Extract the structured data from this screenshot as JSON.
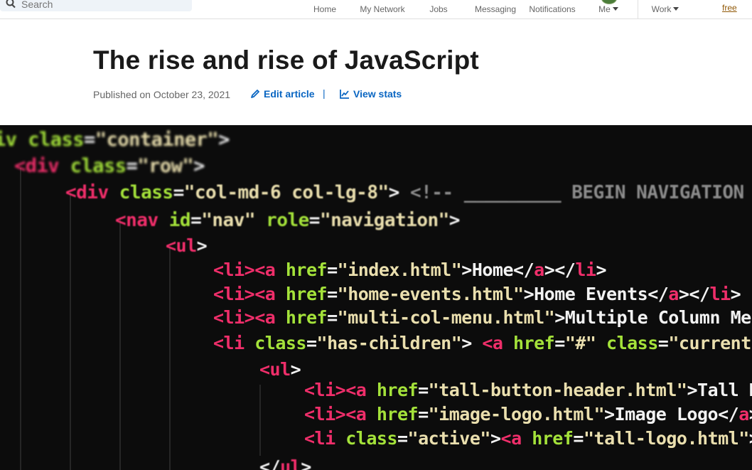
{
  "topbar": {
    "search_placeholder": "Search",
    "nav": [
      {
        "label": "Home",
        "icon": "home-icon"
      },
      {
        "label": "My Network",
        "icon": "network-icon"
      },
      {
        "label": "Jobs",
        "icon": "jobs-icon"
      },
      {
        "label": "Messaging",
        "icon": "messaging-icon"
      },
      {
        "label": "Notifications",
        "icon": "bell-icon"
      },
      {
        "label": "Me",
        "icon": "avatar"
      },
      {
        "label": "Work",
        "icon": "grid-icon"
      }
    ],
    "free_link": "free"
  },
  "article": {
    "title": "The rise and rise of JavaScript",
    "published": "Published on October 23, 2021",
    "edit_label": "Edit article",
    "separator": "|",
    "stats_label": "View stats"
  },
  "cover_code": [
    [
      [
        "t-attr",
        "iv class"
      ],
      [
        "t-txt",
        "="
      ],
      [
        "t-str",
        "\"container\""
      ],
      [
        "t-txt",
        ">"
      ]
    ],
    [
      [
        "t-tag",
        "<div "
      ],
      [
        "t-attr",
        "class"
      ],
      [
        "t-txt",
        "="
      ],
      [
        "t-str",
        "\"row\""
      ],
      [
        "t-txt",
        ">"
      ]
    ],
    [
      [
        "t-tag",
        "<div "
      ],
      [
        "t-attr",
        "class"
      ],
      [
        "t-txt",
        "="
      ],
      [
        "t-str",
        "\"col-md-6 col-lg-8\""
      ],
      [
        "t-txt",
        "> "
      ],
      [
        "t-cmt",
        "<!-- _________ BEGIN NAVIGATION"
      ]
    ],
    [
      [
        "t-tag",
        "<nav "
      ],
      [
        "t-attr",
        "id"
      ],
      [
        "t-txt",
        "="
      ],
      [
        "t-str",
        "\"nav\" "
      ],
      [
        "t-attr",
        "role"
      ],
      [
        "t-txt",
        "="
      ],
      [
        "t-str",
        "\"navigation\""
      ],
      [
        "t-txt",
        ">"
      ]
    ],
    [
      [
        "t-tag",
        "<ul"
      ],
      [
        "t-txt",
        ">"
      ]
    ],
    [
      [
        "t-tag",
        "<li><a "
      ],
      [
        "t-attr",
        "href"
      ],
      [
        "t-txt",
        "="
      ],
      [
        "t-str",
        "\"index.html\""
      ],
      [
        "t-txt",
        ">Home</"
      ],
      [
        "t-tag",
        "a"
      ],
      [
        "t-txt",
        "></"
      ],
      [
        "t-tag",
        "li"
      ],
      [
        "t-txt",
        ">"
      ]
    ],
    [
      [
        "t-tag",
        "<li><a "
      ],
      [
        "t-attr",
        "href"
      ],
      [
        "t-txt",
        "="
      ],
      [
        "t-str",
        "\"home-events.html\""
      ],
      [
        "t-txt",
        ">Home Events</"
      ],
      [
        "t-tag",
        "a"
      ],
      [
        "t-txt",
        "></"
      ],
      [
        "t-tag",
        "li"
      ],
      [
        "t-txt",
        ">"
      ]
    ],
    [
      [
        "t-tag",
        "<li><a "
      ],
      [
        "t-attr",
        "href"
      ],
      [
        "t-txt",
        "="
      ],
      [
        "t-str",
        "\"multi-col-menu.html\""
      ],
      [
        "t-txt",
        ">Multiple Column Menu"
      ]
    ],
    [
      [
        "t-tag",
        "<li "
      ],
      [
        "t-attr",
        "class"
      ],
      [
        "t-txt",
        "="
      ],
      [
        "t-str",
        "\"has-children\""
      ],
      [
        "t-txt",
        "> "
      ],
      [
        "t-tag",
        "<a "
      ],
      [
        "t-attr",
        "href"
      ],
      [
        "t-txt",
        "="
      ],
      [
        "t-str",
        "\"#\" "
      ],
      [
        "t-attr",
        "class"
      ],
      [
        "t-txt",
        "="
      ],
      [
        "t-str",
        "\"current\""
      ]
    ],
    [
      [
        "t-tag",
        "<ul"
      ],
      [
        "t-txt",
        ">"
      ]
    ],
    [
      [
        "t-tag",
        "<li><a "
      ],
      [
        "t-attr",
        "href"
      ],
      [
        "t-txt",
        "="
      ],
      [
        "t-str",
        "\"tall-button-header.html\""
      ],
      [
        "t-txt",
        ">Tall Button"
      ]
    ],
    [
      [
        "t-tag",
        "<li><a "
      ],
      [
        "t-attr",
        "href"
      ],
      [
        "t-txt",
        "="
      ],
      [
        "t-str",
        "\"image-logo.html\""
      ],
      [
        "t-txt",
        ">Image Logo</"
      ],
      [
        "t-tag",
        "a"
      ],
      [
        "t-txt",
        "></"
      ]
    ],
    [
      [
        "t-tag",
        "<li "
      ],
      [
        "t-attr",
        "class"
      ],
      [
        "t-txt",
        "="
      ],
      [
        "t-str",
        "\"active\""
      ],
      [
        "t-txt",
        ">"
      ],
      [
        "t-tag",
        "<a "
      ],
      [
        "t-attr",
        "href"
      ],
      [
        "t-txt",
        "="
      ],
      [
        "t-str",
        "\"tall-logo.html\""
      ],
      [
        "t-txt",
        ">Tall"
      ]
    ],
    [
      [
        "t-txt",
        "</"
      ],
      [
        "t-tag",
        "ul"
      ],
      [
        "t-txt",
        ">"
      ]
    ]
  ]
}
